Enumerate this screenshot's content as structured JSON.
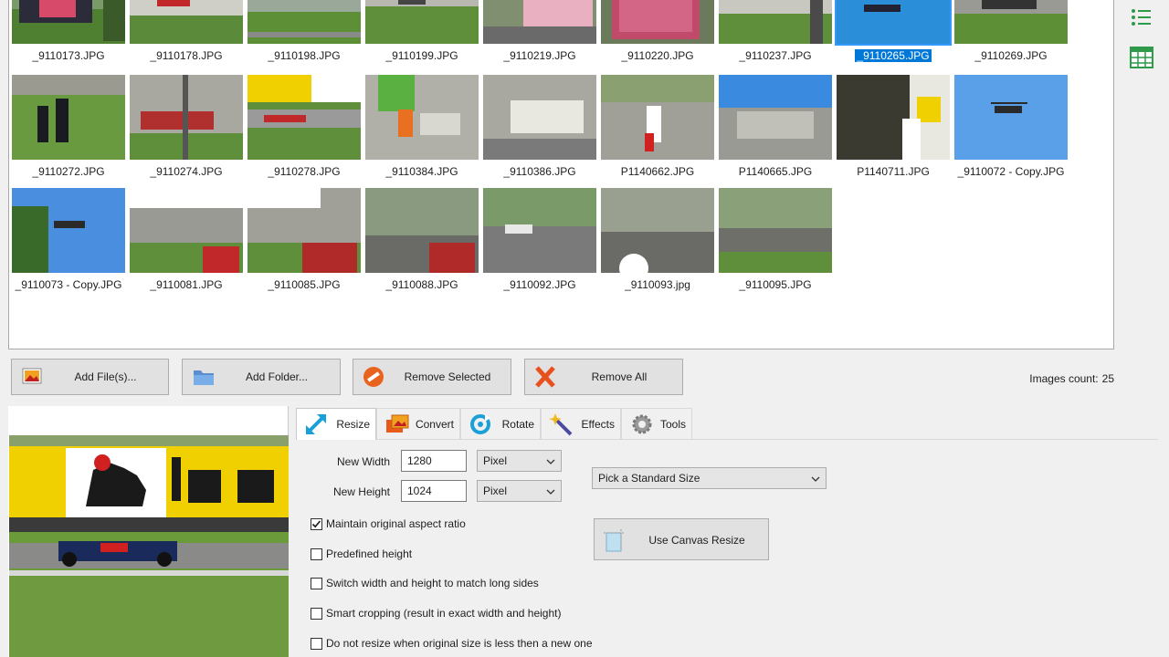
{
  "gallery": {
    "rows": [
      [
        {
          "file": "_9110173.JPG"
        },
        {
          "file": "_9110178.JPG"
        },
        {
          "file": "_9110198.JPG"
        },
        {
          "file": "_9110199.JPG"
        },
        {
          "file": "_9110219.JPG"
        },
        {
          "file": "_9110220.JPG"
        },
        {
          "file": "_9110237.JPG"
        },
        {
          "file": "_9110265.JPG",
          "selected": true
        },
        {
          "file": "_9110269.JPG"
        }
      ],
      [
        {
          "file": "_9110272.JPG"
        },
        {
          "file": "_9110274.JPG"
        },
        {
          "file": "_9110278.JPG"
        },
        {
          "file": "_9110384.JPG"
        },
        {
          "file": "_9110386.JPG"
        },
        {
          "file": "P1140662.JPG"
        },
        {
          "file": "P1140665.JPG"
        },
        {
          "file": "P1140711.JPG"
        },
        {
          "file": "_9110072 - Copy.JPG"
        }
      ],
      [
        {
          "file": "_9110073 - Copy.JPG"
        },
        {
          "file": "_9110081.JPG"
        },
        {
          "file": "_9110085.JPG"
        },
        {
          "file": "_9110088.JPG"
        },
        {
          "file": "_9110092.JPG"
        },
        {
          "file": "_9110093.jpg"
        },
        {
          "file": "_9110095.JPG"
        }
      ]
    ]
  },
  "toolbar": {
    "add_files": "Add File(s)...",
    "add_folder": "Add Folder...",
    "remove_selected": "Remove Selected",
    "remove_all": "Remove All",
    "images_count_label": "Images count:",
    "images_count_value": "25"
  },
  "tabs": [
    {
      "label": "Resize",
      "icon": "resize-icon",
      "active": true
    },
    {
      "label": "Convert",
      "icon": "convert-icon"
    },
    {
      "label": "Rotate",
      "icon": "rotate-icon"
    },
    {
      "label": "Effects",
      "icon": "effects-icon"
    },
    {
      "label": "Tools",
      "icon": "gear-icon"
    }
  ],
  "resize": {
    "width_label": "New Width",
    "width_value": "1280",
    "height_label": "New Height",
    "height_value": "1024",
    "width_unit": "Pixel",
    "height_unit": "Pixel",
    "standard_size": "Pick a Standard Size",
    "canvas_resize": "Use Canvas Resize",
    "options": [
      {
        "label": "Maintain original aspect ratio",
        "checked": true
      },
      {
        "label": "Predefined height",
        "checked": false
      },
      {
        "label": "Switch width and height to match long sides",
        "checked": false
      },
      {
        "label": "Smart cropping (result in exact width and height)",
        "checked": false
      },
      {
        "label": "Do not resize when original size is less then a new one",
        "checked": false
      }
    ]
  },
  "colors": {
    "selection": "#0078d7",
    "sky": "#4a90d9",
    "grass": "#5f8f3a",
    "eni_yellow": "#f0d000"
  }
}
